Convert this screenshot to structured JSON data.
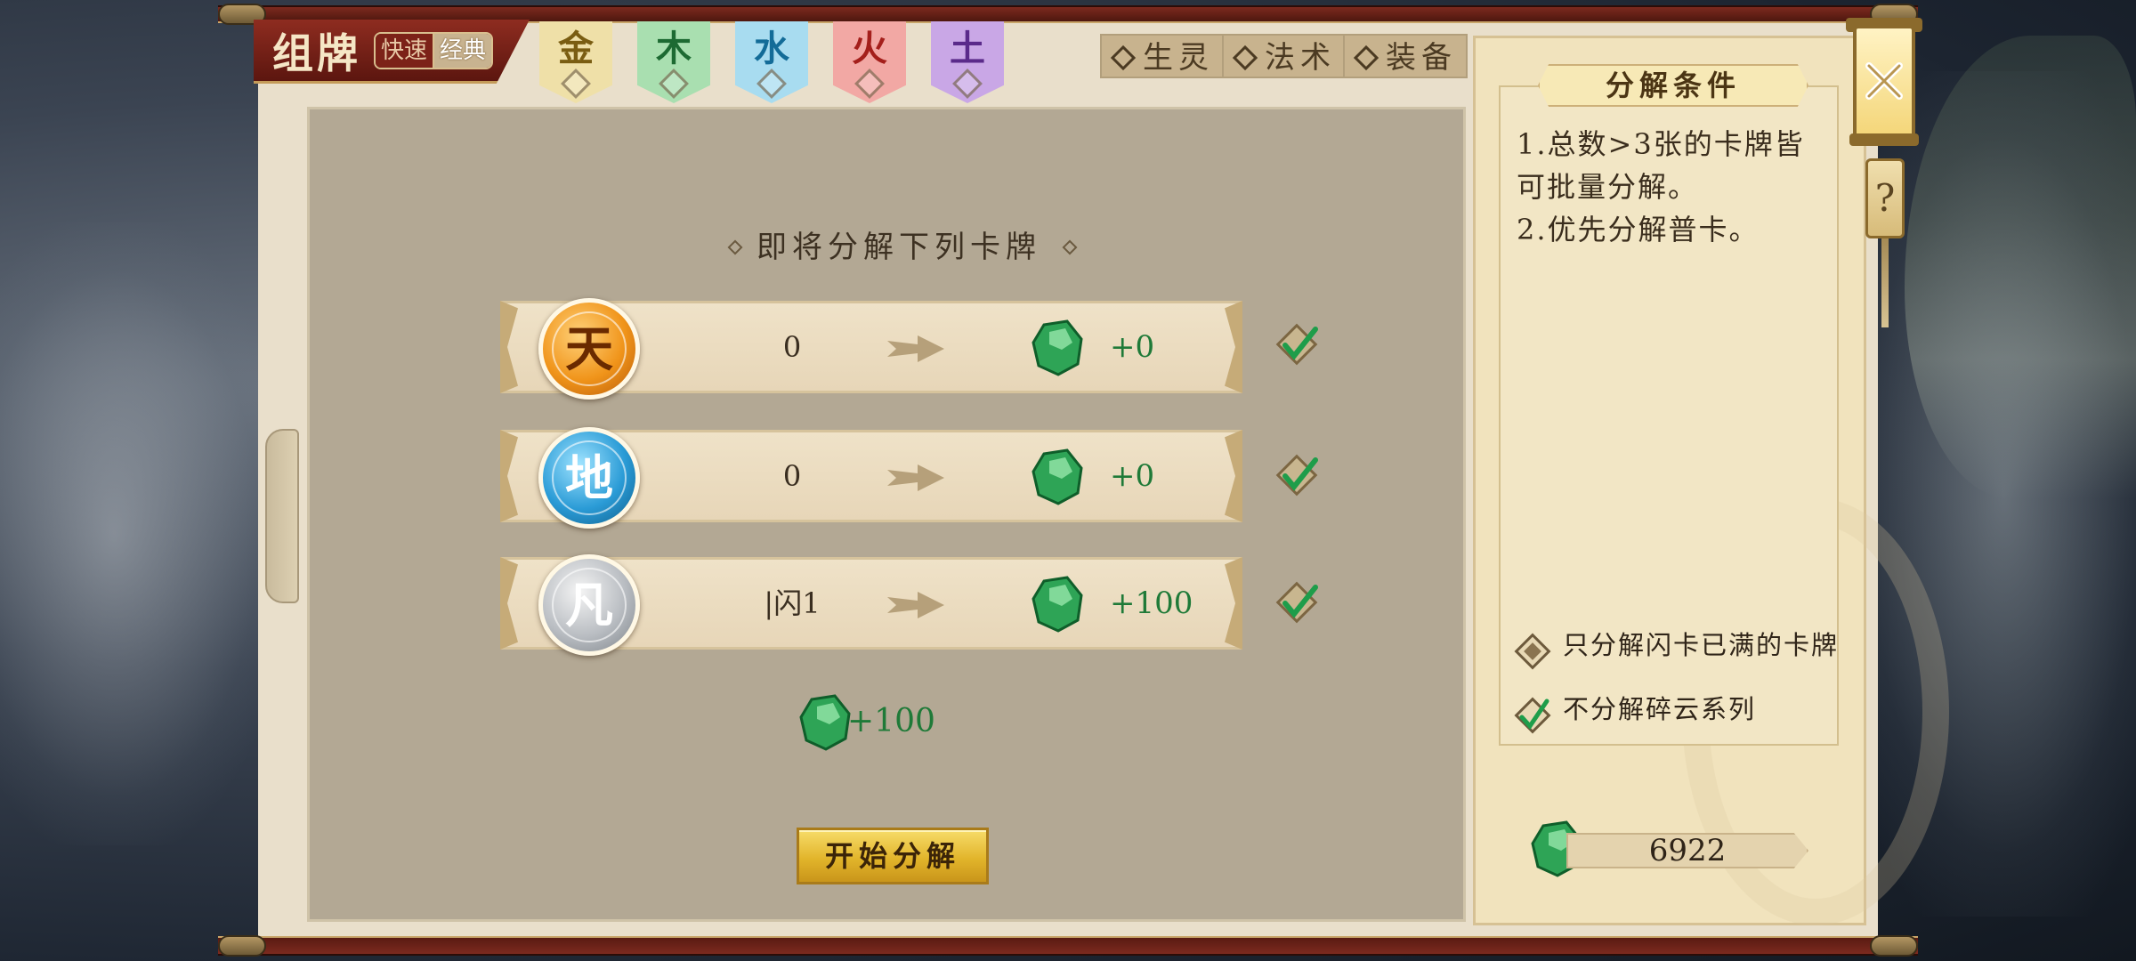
{
  "header": {
    "title": "组牌",
    "mode_inactive": "快速",
    "mode_active": "经典"
  },
  "elements": [
    {
      "label": "金",
      "color": "#efe0a8",
      "text_color": "#7a5d12"
    },
    {
      "label": "木",
      "color": "#a9dfb0",
      "text_color": "#1d6a32"
    },
    {
      "label": "水",
      "color": "#a8dcf0",
      "text_color": "#136c98"
    },
    {
      "label": "火",
      "color": "#f2a8a4",
      "text_color": "#a41f1b"
    },
    {
      "label": "土",
      "color": "#c9a7e6",
      "text_color": "#5a2a8a"
    }
  ],
  "categories": [
    "生灵",
    "法术",
    "装备"
  ],
  "main": {
    "section_title": "即将分解下列卡牌",
    "rows": [
      {
        "medal": "天",
        "count": "0",
        "gain": "+0",
        "checked": true
      },
      {
        "medal": "地",
        "count": "0",
        "gain": "+0",
        "checked": true
      },
      {
        "medal": "凡",
        "count": "|闪1",
        "gain": "+100",
        "checked": true
      }
    ],
    "total_gain": "+100",
    "start_button": "开始分解"
  },
  "conditions": {
    "title": "分解条件",
    "rule_1": "1.总数>3张的卡牌皆可批量分解。",
    "rule_2": "2.优先分解普卡。",
    "options": [
      {
        "label": "只分解闪卡已满的卡牌",
        "checked": false
      },
      {
        "label": "不分解碎云系列",
        "checked": true
      }
    ],
    "currency_value": "6922"
  },
  "icons": {
    "close": "close-icon",
    "help": "question-icon",
    "gem": "jade-gem-icon",
    "arrow": "arrow-right-icon",
    "check": "checkmark-icon"
  },
  "help_glyph": "?",
  "close_glyph": "✕"
}
